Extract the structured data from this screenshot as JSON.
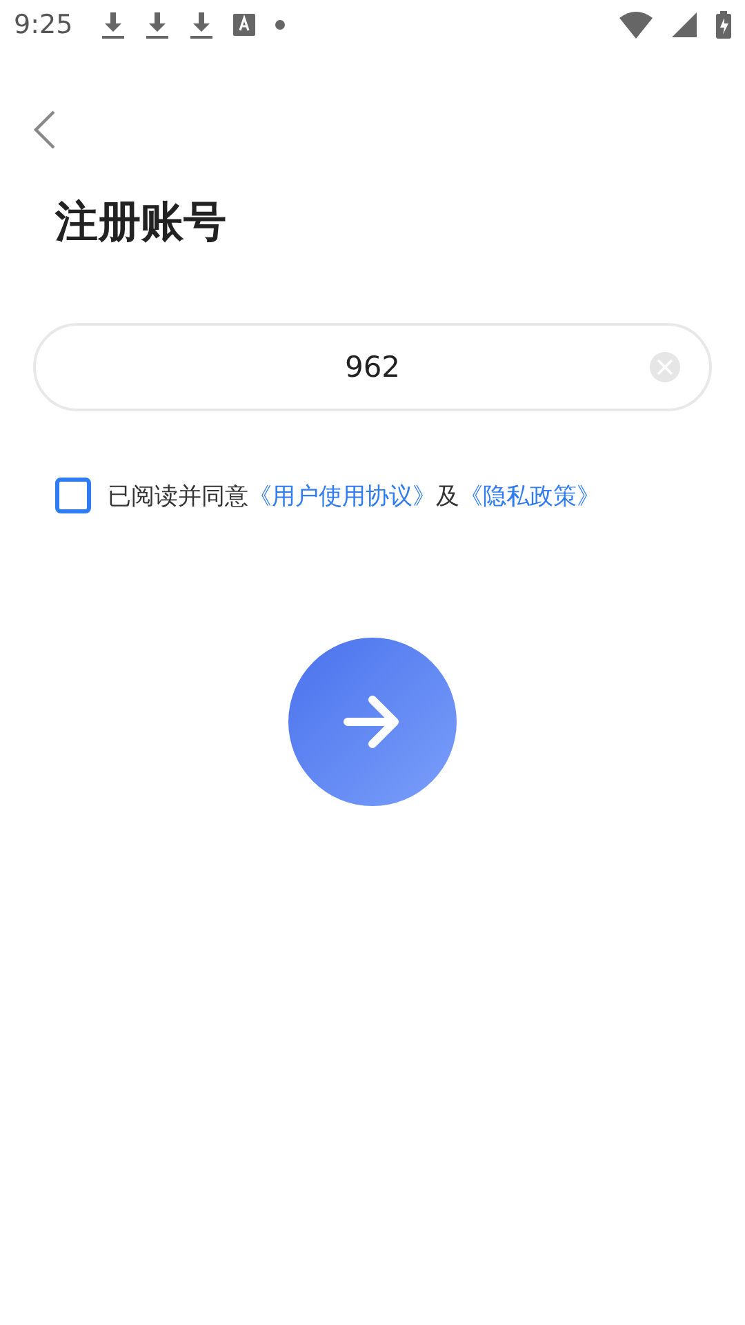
{
  "status_bar": {
    "time": "9:25"
  },
  "title": "注册账号",
  "phone_field": {
    "value": "962"
  },
  "agreement": {
    "checked": false,
    "parts": [
      {
        "kind": "text",
        "text": "已阅读并同意"
      },
      {
        "kind": "link",
        "text": "《用户使用协议》"
      },
      {
        "kind": "text",
        "text": "及"
      },
      {
        "kind": "link",
        "text": "《隐私政策》"
      }
    ]
  }
}
